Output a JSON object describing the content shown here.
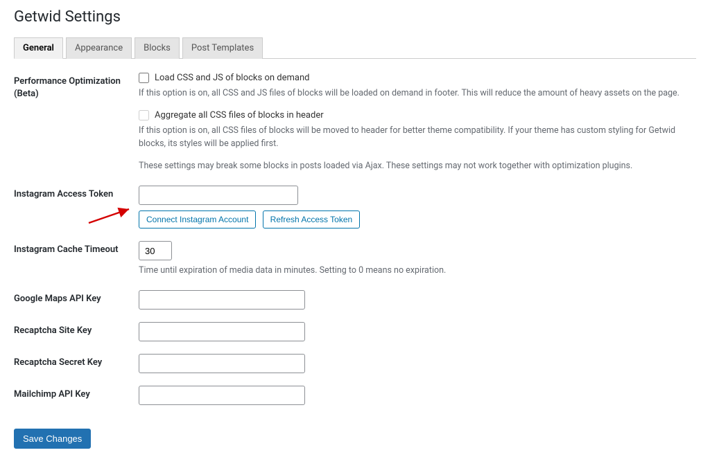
{
  "page_title": "Getwid Settings",
  "tabs": {
    "general": "General",
    "appearance": "Appearance",
    "blocks": "Blocks",
    "post_templates": "Post Templates"
  },
  "perf": {
    "label": "Performance Optimization (Beta)",
    "opt1_label": "Load CSS and JS of blocks on demand",
    "opt1_desc": "If this option is on, all CSS and JS files of blocks will be loaded on demand in footer. This will reduce the amount of heavy assets on the page.",
    "opt2_label": "Aggregate all CSS files of blocks in header",
    "opt2_desc": "If this option is on, all CSS files of blocks will be moved to header for better theme compatibility. If your theme has custom styling for Getwid blocks, its styles will be applied first.",
    "note": "These settings may break some blocks in posts loaded via Ajax. These settings may not work together with optimization plugins."
  },
  "instagram": {
    "token_label": "Instagram Access Token",
    "token_value": "",
    "connect_btn": "Connect Instagram Account",
    "refresh_btn": "Refresh Access Token",
    "cache_label": "Instagram Cache Timeout",
    "cache_value": "30",
    "cache_desc": "Time until expiration of media data in minutes. Setting to 0 means no expiration."
  },
  "gmaps_label": "Google Maps API Key",
  "recaptcha_site_label": "Recaptcha Site Key",
  "recaptcha_secret_label": "Recaptcha Secret Key",
  "mailchimp_label": "Mailchimp API Key",
  "save_btn": "Save Changes"
}
